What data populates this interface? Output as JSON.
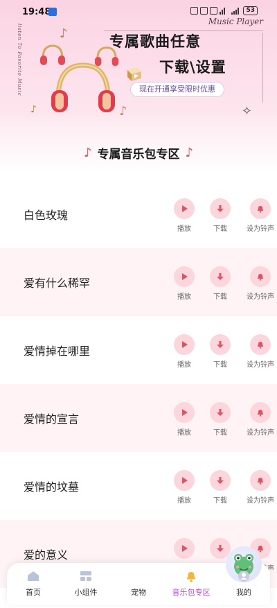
{
  "status_bar": {
    "time": "19:48",
    "battery": "53"
  },
  "banner": {
    "side_text": "listen To Favorite Music",
    "brand": "Music Player",
    "headline_line1": "专属歌曲任意",
    "headline_line2": "下载\\设置",
    "promo": "现在开通享受限时优惠",
    "note_glyph": "♪",
    "sparkle_glyph": "✧"
  },
  "section": {
    "title": "专属音乐包专区",
    "note_glyph": "♪"
  },
  "songs": [
    {
      "name": "白色玫瑰"
    },
    {
      "name": "爱有什么稀罕"
    },
    {
      "name": "爱情掉在哪里"
    },
    {
      "name": "爱情的宣言"
    },
    {
      "name": "爱情的坟墓"
    },
    {
      "name": "爱的意义"
    }
  ],
  "actions": {
    "play": "播放",
    "download": "下载",
    "ringtone": "设为铃声"
  },
  "bottom_nav": {
    "items": [
      {
        "label": "首页",
        "icon": "home-icon"
      },
      {
        "label": "小组件",
        "icon": "widget-icon"
      },
      {
        "label": "宠物",
        "icon": "pet-frog-icon"
      },
      {
        "label": "音乐包专区",
        "icon": "bell-icon",
        "active": true
      },
      {
        "label": "我的",
        "icon": "profile-icon"
      }
    ]
  },
  "colors": {
    "accent": "#e05262",
    "action_circle": "#fbd6dd",
    "nav_active": "#b34cd6",
    "row_alt": "#fff3f5"
  }
}
